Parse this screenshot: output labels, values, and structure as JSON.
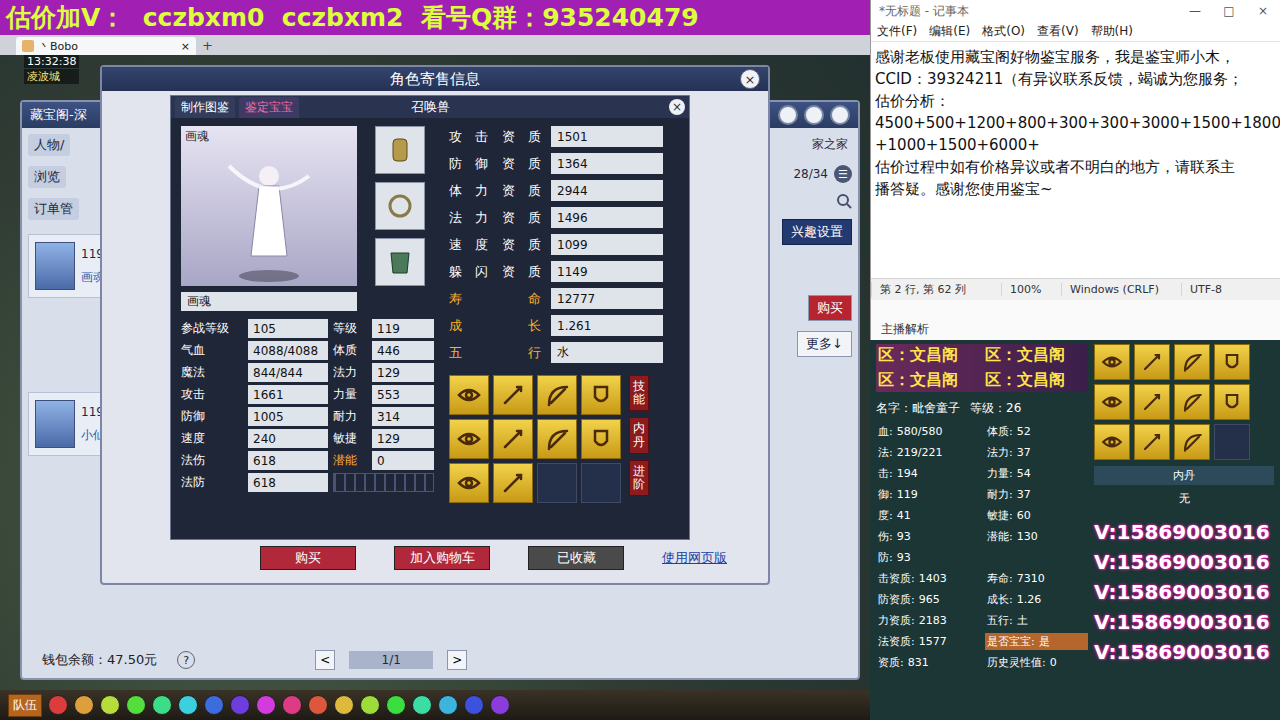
{
  "banner": {
    "text": "估价加V：  cczbxm0  cczbxm2  看号Q群：935240479"
  },
  "game": {
    "tab": {
      "label": "丶Bobo",
      "close": "×",
      "add": "+"
    },
    "time": "13:32:38",
    "location": "凌波城",
    "market": {
      "title": "藏宝阁-深",
      "nav": [
        "人物/",
        "浏览",
        "订单管"
      ],
      "list": [
        {
          "level": "119级",
          "name": "画魂"
        },
        {
          "level": "119级",
          "name": "小仙"
        }
      ],
      "page": "28/34",
      "page_icon": "☰",
      "interest": "兴趣设置",
      "buy": "购买",
      "more": "更多↓",
      "home": "家之家",
      "wallet": "钱包余额：47.50元",
      "help": "?",
      "pager": {
        "prev": "<",
        "page": "1/1",
        "next": ">"
      }
    },
    "dialog": {
      "title": "角色寄售信息",
      "close": "×",
      "buttons": [
        {
          "label": "购买",
          "kind": "primary"
        },
        {
          "label": "加入购物车",
          "kind": "primary"
        },
        {
          "label": "已收藏",
          "kind": "muted"
        }
      ],
      "web_link": "使用网页版"
    },
    "pet": {
      "tabs": [
        {
          "label": "制作图鉴",
          "selected": false
        },
        {
          "label": "鉴定宝宝",
          "selected": true
        }
      ],
      "title": "召唤兽",
      "close": "×",
      "portrait_label": "画魂",
      "name": "画魂",
      "stats": [
        [
          {
            "label": "参战等级",
            "value": "105",
            "kind": "normal"
          },
          {
            "label": "等级",
            "value": "119",
            "kind": "normal"
          }
        ],
        [
          {
            "label": "气血",
            "value": "4088/4088",
            "kind": "normal"
          },
          {
            "label": "体质",
            "value": "446",
            "kind": "normal"
          }
        ],
        [
          {
            "label": "魔法",
            "value": "844/844",
            "kind": "normal"
          },
          {
            "label": "法力",
            "value": "129",
            "kind": "normal"
          }
        ],
        [
          {
            "label": "攻击",
            "value": "1661",
            "kind": "normal"
          },
          {
            "label": "力量",
            "value": "553",
            "kind": "normal"
          }
        ],
        [
          {
            "label": "防御",
            "value": "1005",
            "kind": "normal"
          },
          {
            "label": "耐力",
            "value": "314",
            "kind": "normal"
          }
        ],
        [
          {
            "label": "速度",
            "value": "240",
            "kind": "normal"
          },
          {
            "label": "敏捷",
            "value": "129",
            "kind": "normal"
          }
        ],
        [
          {
            "label": "法伤",
            "value": "618",
            "kind": "normal"
          },
          {
            "label": "潜能",
            "value": "0",
            "kind": "special"
          }
        ],
        [
          {
            "label": "法防",
            "value": "618",
            "kind": "normal"
          }
        ]
      ],
      "aptitudes": [
        {
          "label": "攻击资质",
          "value": "1501",
          "kind": "aptitude"
        },
        {
          "label": "防御资质",
          "value": "1364",
          "kind": "aptitude"
        },
        {
          "label": "体力资质",
          "value": "2944",
          "kind": "aptitude"
        },
        {
          "label": "法力资质",
          "value": "1496",
          "kind": "aptitude"
        },
        {
          "label": "速度资质",
          "value": "1099",
          "kind": "aptitude"
        },
        {
          "label": "躲闪资质",
          "value": "1149",
          "kind": "aptitude"
        },
        {
          "label": "寿命",
          "value": "12777",
          "kind": "trait"
        },
        {
          "label": "成长",
          "value": "1.261",
          "kind": "trait"
        },
        {
          "label": "五行",
          "value": "水",
          "kind": "trait"
        }
      ],
      "skills": [
        {
          "filled": true
        },
        {
          "filled": true
        },
        {
          "filled": true
        },
        {
          "filled": true
        },
        {
          "filled": true
        },
        {
          "filled": true
        },
        {
          "filled": true
        },
        {
          "filled": true
        },
        {
          "filled": true
        },
        {
          "filled": true
        },
        {
          "filled": false
        },
        {
          "filled": false
        }
      ],
      "side_buttons": [
        "技能",
        "内丹",
        "进阶"
      ]
    },
    "toolbar": {
      "team": "队伍"
    }
  },
  "notepad": {
    "title": "*无标题 - 记事本",
    "controls": [
      "—",
      "□",
      "×"
    ],
    "menus": [
      "文件(F)",
      "编辑(E)",
      "格式(O)",
      "查看(V)",
      "帮助(H)"
    ],
    "lines": [
      "感谢老板使用藏宝阁好物鉴宝服务，我是鉴宝师小木，",
      "CCID：39324211（有异议联系反馈，竭诚为您服务；",
      "估价分析：",
      "4500+500+1200+800+300+300+3000+1500+1800",
      "+1000+1500+6000+",
      "估价过程中如有价格异议或者不明白的地方，请联系主",
      "播答疑。感谢您使用鉴宝~"
    ],
    "status": [
      "第 2 行, 第 62 列",
      "100%",
      "Windows (CRLF)",
      "UTF-8"
    ]
  },
  "note_below": "主播解析",
  "stream": {
    "servers": [
      "区：文昌阁",
      "区：文昌阁",
      "区：文昌阁",
      "区：文昌阁"
    ],
    "name": "名字：毗舍童子",
    "level": "等级：26",
    "stats": [
      [
        {
          "label": "血:",
          "value": "580/580"
        },
        {
          "label": "体质:",
          "value": "52"
        }
      ],
      [
        {
          "label": "法:",
          "value": "219/221"
        },
        {
          "label": "法力:",
          "value": "37"
        }
      ],
      [
        {
          "label": "击:",
          "value": "194"
        },
        {
          "label": "力量:",
          "value": "54"
        }
      ],
      [
        {
          "label": "御:",
          "value": "119"
        },
        {
          "label": "耐力:",
          "value": "37"
        }
      ],
      [
        {
          "label": "度:",
          "value": "41"
        },
        {
          "label": "敏捷:",
          "value": "60"
        }
      ],
      [
        {
          "label": "伤:",
          "value": "93"
        },
        {
          "label": "潜能:",
          "value": "130"
        }
      ],
      [
        {
          "label": "防:",
          "value": "93"
        }
      ]
    ],
    "aptitudes": [
      [
        {
          "label": "击资质:",
          "value": "1403",
          "kind": "normal"
        },
        {
          "label": "寿命:",
          "value": "7310",
          "kind": "normal"
        }
      ],
      [
        {
          "label": "防资质:",
          "value": "965",
          "kind": "normal"
        },
        {
          "label": "成长:",
          "value": "1.26",
          "kind": "normal"
        }
      ],
      [
        {
          "label": "力资质:",
          "value": "2183",
          "kind": "normal"
        },
        {
          "label": "五行:",
          "value": "土",
          "kind": "normal"
        }
      ],
      [
        {
          "label": "法资质:",
          "value": "1577",
          "kind": "normal"
        },
        {
          "label": "是否宝宝:",
          "value": "是",
          "kind": "highlight"
        }
      ],
      [
        {
          "label": "资质:",
          "value": "831",
          "kind": "normal"
        },
        {
          "label": "历史灵性值:",
          "value": "0",
          "kind": "normal"
        }
      ]
    ],
    "skills": [
      {
        "filled": true
      },
      {
        "filled": true
      },
      {
        "filled": true
      },
      {
        "filled": true
      },
      {
        "filled": true
      },
      {
        "filled": true
      },
      {
        "filled": true
      },
      {
        "filled": true
      },
      {
        "filled": true
      },
      {
        "filled": true
      },
      {
        "filled": true
      },
      {
        "filled": false
      }
    ],
    "neidan": {
      "title": "内丹",
      "value": "无"
    },
    "contacts": [
      "V:15869003016",
      "V:15869003016",
      "V:15869003016",
      "V:15869003016",
      "V:15869003016"
    ]
  }
}
